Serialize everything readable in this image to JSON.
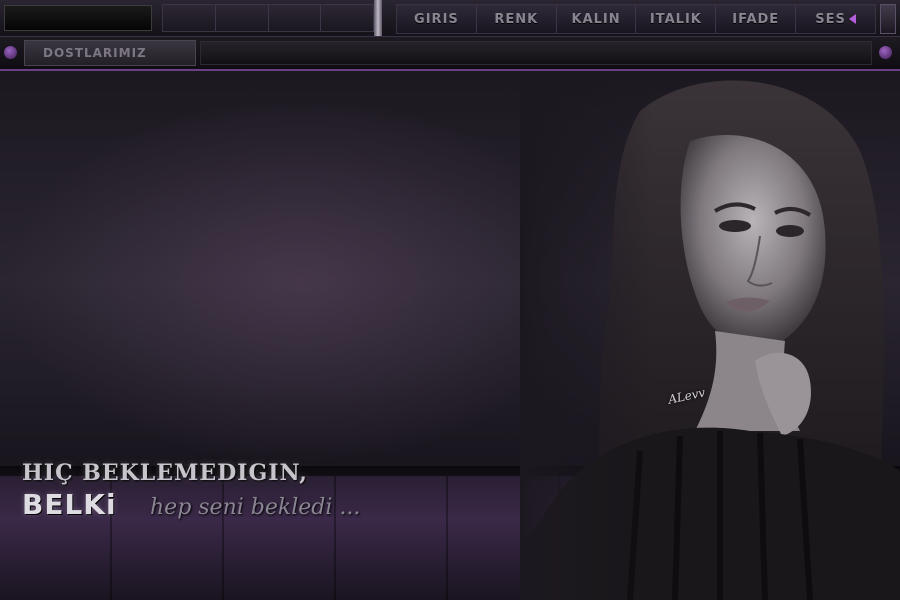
{
  "toolbar": {
    "menu": [
      {
        "id": "giris",
        "label": "GIRIS"
      },
      {
        "id": "renk",
        "label": "RENK"
      },
      {
        "id": "kalin",
        "label": "KALIN"
      },
      {
        "id": "italik",
        "label": "ITALIK"
      },
      {
        "id": "ifade",
        "label": "IFADE"
      },
      {
        "id": "ses",
        "label": "SES"
      }
    ]
  },
  "subbar": {
    "friends_tab": "DOSTLARIMIZ"
  },
  "captions": {
    "line1": "HIÇ BEKLEMEDIGIN,",
    "big": "BELKi",
    "script": "hep seni bekledi ..."
  },
  "watermark": "ALevv",
  "colors": {
    "accent": "#8e4cb5",
    "bar_bg": "#1a161e",
    "menu_text": "#8a8490"
  }
}
